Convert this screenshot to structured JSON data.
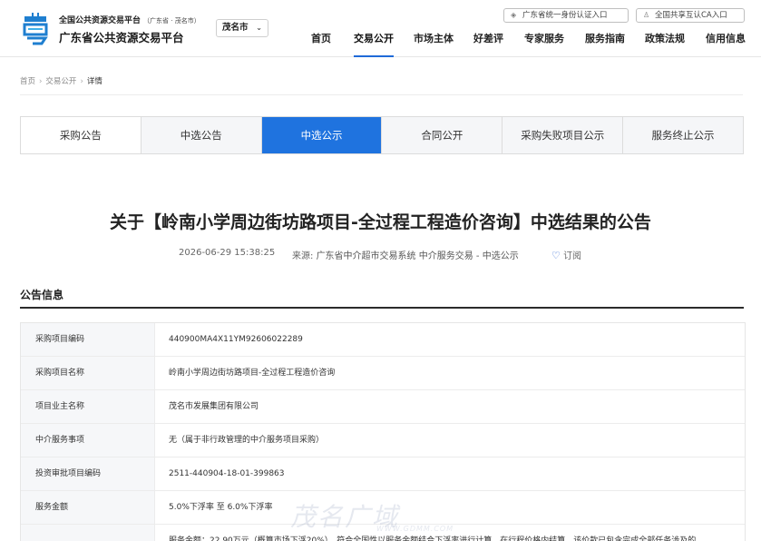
{
  "header": {
    "platform_line1": "全国公共资源交易平台",
    "platform_line1_region": "（广东省 · 茂名市）",
    "platform_line2": "广东省公共资源交易平台",
    "city": "茂名市",
    "auth_gd": "广东省统一身份认证入口",
    "auth_ca": "全国共享互认CA入口",
    "nav": [
      "首页",
      "交易公开",
      "市场主体",
      "好差评",
      "专家服务",
      "服务指南",
      "政策法规",
      "信用信息"
    ]
  },
  "breadcrumb": {
    "home": "首页",
    "trade": "交易公开",
    "current": "详情"
  },
  "tabs": [
    "采购公告",
    "中选公告",
    "中选公示",
    "合同公开",
    "采购失败项目公示",
    "服务终止公示"
  ],
  "article": {
    "title": "关于【岭南小学周边街坊路项目-全过程工程造价咨询】中选结果的公告",
    "datetime": "2026-06-29 15:38:25",
    "source_label": "来源:",
    "source": "广东省中介超市交易系统 中介服务交易 - 中选公示",
    "subscribe": "订阅"
  },
  "section": {
    "title": "公告信息",
    "rows": [
      {
        "key": "采购项目编码",
        "value": "440900MA4X11YM92606022289"
      },
      {
        "key": "采购项目名称",
        "value": "岭南小学周边街坊路项目-全过程工程造价咨询"
      },
      {
        "key": "项目业主名称",
        "value": "茂名市发展集团有限公司"
      },
      {
        "key": "中介服务事项",
        "value": "无（属于非行政管理的中介服务项目采购）"
      },
      {
        "key": "投资审批项目编码",
        "value": "2511-440904-18-01-399863"
      },
      {
        "key": "服务金额",
        "value": "5.0%下浮率 至 6.0%下浮率"
      },
      {
        "key": "",
        "value": "服务金额：22.90万元（概算市场下浮20%），符合全国性以服务金额结合下浮率进行计算，在行程价格内结算，该价款已包含完成全部任务涉及的"
      }
    ]
  },
  "watermark": {
    "text": "茂名广域",
    "url": "WWW.GDMM.COM"
  },
  "colors": {
    "accent": "#1f73df",
    "nav_active_underline": "#1f6ad8"
  }
}
